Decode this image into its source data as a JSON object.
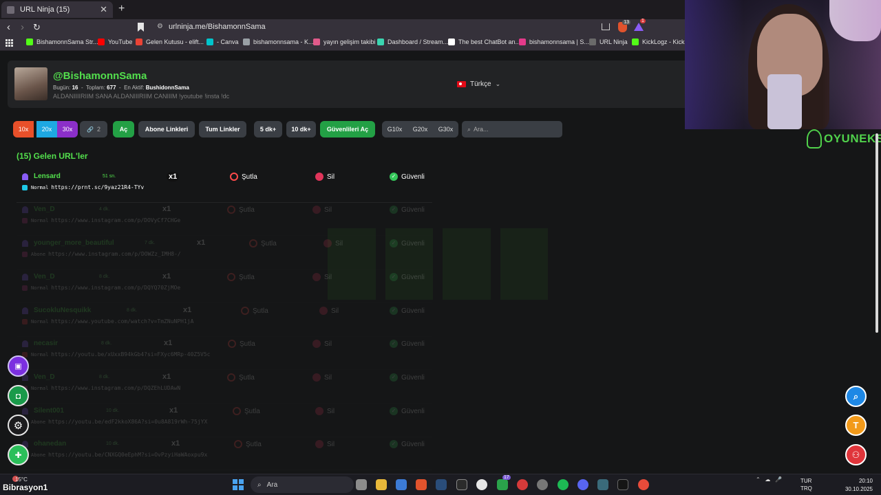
{
  "browser": {
    "tab_title": "URL Ninja (15)",
    "tab_close": "✕",
    "new_tab": "+",
    "url": "urlninja.me/BishamonnSama",
    "extension_badges": [
      "13",
      "1"
    ],
    "bookmarks": [
      {
        "label": "BishamonnSama Str...",
        "color": "#53fc18"
      },
      {
        "label": "YouTube",
        "color": "#ff0000"
      },
      {
        "label": "Gelen Kutusu - elift...",
        "color": "#ea4335"
      },
      {
        "label": "- Canva",
        "color": "#00c4cc"
      },
      {
        "label": "bishamonnsama - K...",
        "color": "#9aa0a6"
      },
      {
        "label": "yayın gelişim takibi",
        "color": "#e05a8a"
      },
      {
        "label": "Dashboard / Stream...",
        "color": "#3bd5b0"
      },
      {
        "label": "The best ChatBot an...",
        "color": "#ffffff"
      },
      {
        "label": "bishamonnsama | S...",
        "color": "#e43a8a"
      },
      {
        "label": "URL Ninja",
        "color": "#6a6a6a"
      },
      {
        "label": "KickLogz - Kick Ya",
        "color": "#53fc18"
      }
    ]
  },
  "profile": {
    "handle": "@BishamonnSama",
    "today_label": "Bugün:",
    "today_value": "16",
    "total_label": "Toplam:",
    "total_value": "677",
    "most_active_label": "En Aktif:",
    "most_active_value": "BushidonnSama",
    "bio": "ALDANIIIIRIIM SANA ALDANIIIRIIM CANIIIM !youtube !insta !dc",
    "language": "Türkçe"
  },
  "controls": [
    {
      "label": "10x",
      "bg": "#e8502a"
    },
    {
      "label": "20x",
      "bg": "#1ea8e2"
    },
    {
      "label": "30x",
      "bg": "#8b2fc9"
    },
    {
      "label": "2",
      "bg": "#3a3e44"
    },
    {
      "label": "Aç",
      "bg": "#23a045"
    },
    {
      "label": "Abone Linkleri",
      "bg": "#3a3e44"
    },
    {
      "label": "Tum Linkler",
      "bg": "#3a3e44"
    },
    {
      "label": "5 dk+",
      "bg": "#3a3e44"
    },
    {
      "label": "10 dk+",
      "bg": "#3a3e44"
    },
    {
      "label": "Güvenlileri Aç",
      "bg": "#23a045"
    },
    {
      "label": "G10x",
      "bg": "#3a3e44"
    },
    {
      "label": "G20x",
      "bg": "#3a3e44"
    },
    {
      "label": "G30x",
      "bg": "#3a3e44"
    }
  ],
  "search_placeholder": "Ara...",
  "section_title": "(15) Gelen URL'ler",
  "actions": {
    "ban": "Şutla",
    "delete": "Sil",
    "safe": "Güvenli"
  },
  "urls": [
    {
      "user": "Lensard",
      "time": "51 sn.",
      "mult": "x1",
      "type": "Normal",
      "url": "https://prnt.sc/9yaz21R4-TYv"
    },
    {
      "user": "Ven_D",
      "time": "4 dk.",
      "mult": "x1",
      "type": "Normal",
      "url": "https://www.instagram.com/p/DOVyCf7CHGe"
    },
    {
      "user": "younger_more_beautiful",
      "time": "7 dk.",
      "mult": "x1",
      "type": "Abone",
      "url": "https://www.instagram.com/p/DOWZz_IMH8-/"
    },
    {
      "user": "Ven_D",
      "time": "8 dk.",
      "mult": "x1",
      "type": "Normal",
      "url": "https://www.instagram.com/p/DQYQ70ZjMOe"
    },
    {
      "user": "SucokluNesquikk",
      "time": "8 dk.",
      "mult": "x1",
      "type": "Normal",
      "url": "https://www.youtube.com/watch?v=TmZNuNPH1jA"
    },
    {
      "user": "necasir",
      "time": "8 dk.",
      "mult": "x1",
      "type": "Normal",
      "url": "https://youtu.be/xUxxB94kGb4?si=FXyc6MRp-40Z5V5c"
    },
    {
      "user": "Ven_D",
      "time": "8 dk.",
      "mult": "x1",
      "type": "Normal",
      "url": "https://www.instagram.com/p/DQZEhLUDAwN"
    },
    {
      "user": "Silent001",
      "time": "10 dk.",
      "mult": "x1",
      "type": "Abone",
      "url": "https://youtu.be/edF2kkoX86A?si=0u8A819rWh-75jYX"
    },
    {
      "user": "ohanedan",
      "time": "10 dk.",
      "mult": "x1",
      "type": "Abone",
      "url": "https://youtu.be/CNXGQ0eEphM?si=OvPzyiHaWAoxpu9x"
    }
  ],
  "overlay": {
    "brand": "OYUNEKS",
    "streamer": "Bibrasyon1",
    "sponsor_letter": "T"
  },
  "taskbar": {
    "weather": "15°C",
    "search": "Ara",
    "lang": "TUR",
    "lang2": "TRQ",
    "time": "20:10",
    "date": "30.10.2025",
    "badge": "17"
  }
}
